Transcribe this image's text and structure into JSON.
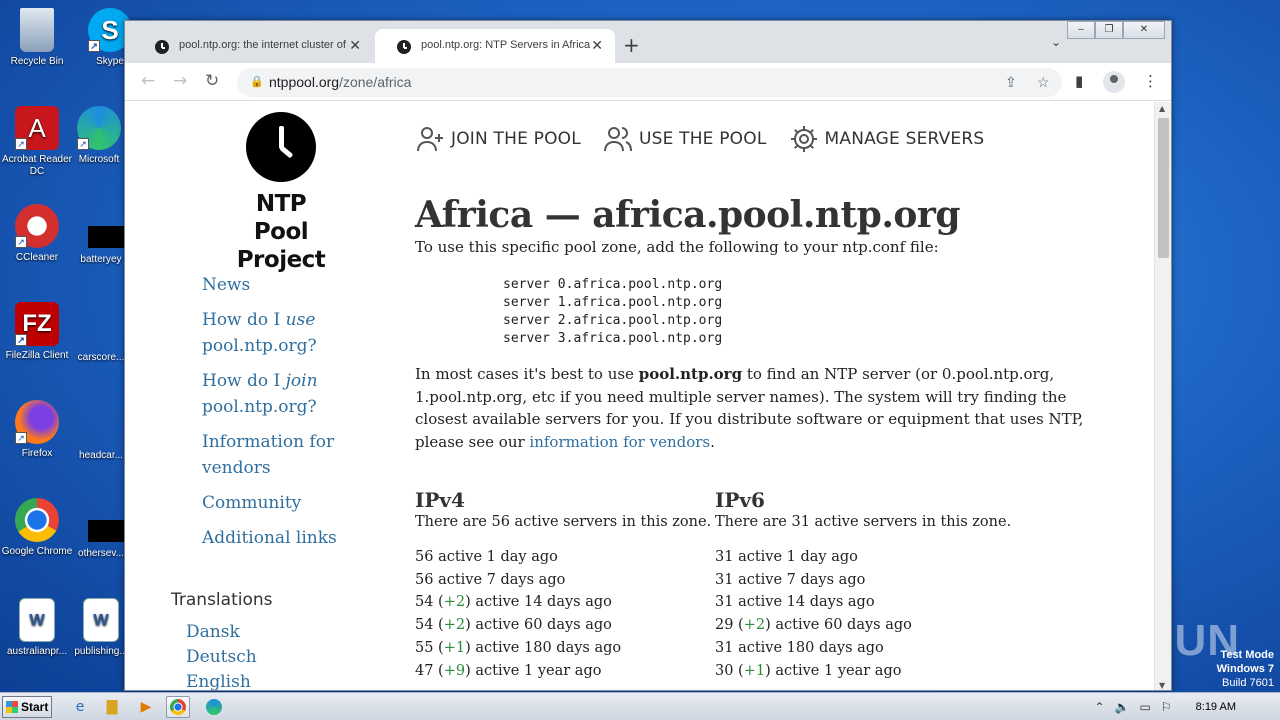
{
  "desktop": {
    "icons": [
      {
        "label": "Recycle Bin"
      },
      {
        "label": "Skype"
      },
      {
        "label": "Acrobat Reader DC"
      },
      {
        "label": "Microsoft"
      },
      {
        "label": "CCleaner"
      },
      {
        "label": "batteryey"
      },
      {
        "label": "FileZilla Client"
      },
      {
        "label": "carscore..."
      },
      {
        "label": "Firefox"
      },
      {
        "label": "headcar..."
      },
      {
        "label": "Google Chrome"
      },
      {
        "label": "othersev..."
      },
      {
        "label": "australianpr..."
      },
      {
        "label": "publishing..."
      }
    ],
    "watermark": "ANY.RUN",
    "test_mode": {
      "line1": "Test Mode",
      "line2": "Windows 7",
      "line3": "Build 7601"
    }
  },
  "taskbar": {
    "start_label": "Start",
    "clock": "8:19 AM"
  },
  "browser": {
    "tabs": [
      {
        "title": "pool.ntp.org: the internet cluster of",
        "active": false
      },
      {
        "title": "pool.ntp.org: NTP Servers in Africa,",
        "active": true
      }
    ],
    "url_host": "ntppool.org",
    "url_path": "/zone/africa"
  },
  "page": {
    "logo_line1": "NTP Pool",
    "logo_line2": "Project",
    "sidenav": {
      "news": "News",
      "use_prefix": "How do I ",
      "use_em": "use",
      "use_suffix": "pool.ntp.org?",
      "join_prefix": "How do I ",
      "join_em": "join",
      "join_suffix": "pool.ntp.org?",
      "vendors": "Information for vendors",
      "community": "Community",
      "links": "Additional links"
    },
    "translations_title": "Translations",
    "languages": [
      "Dansk",
      "Deutsch",
      "English"
    ],
    "topnav": {
      "join": "JOIN THE POOL",
      "use": "USE THE POOL",
      "manage": "MANAGE SERVERS"
    },
    "title": "Africa — africa.pool.ntp.org",
    "intro": "To use this specific pool zone, add the following to your ntp.conf file:",
    "servers": [
      "server 0.africa.pool.ntp.org",
      "server 1.africa.pool.ntp.org",
      "server 2.africa.pool.ntp.org",
      "server 3.africa.pool.ntp.org"
    ],
    "para": {
      "p1": "In most cases it's best to use ",
      "bold": "pool.ntp.org",
      "p2": " to find an NTP server (or 0.pool.ntp.org, 1.pool.ntp.org, etc if you need multiple server names). The system will try finding the closest available servers for you. If you distribute software or equipment that uses NTP, please see our ",
      "link": "information for vendors",
      "p3": "."
    },
    "ipv4": {
      "heading": "IPv4",
      "summary": "There are 56 active servers in this zone.",
      "stats": [
        {
          "count": "56",
          "delta": "",
          "label": "active 1 day ago"
        },
        {
          "count": "56",
          "delta": "",
          "label": "active 7 days ago"
        },
        {
          "count": "54",
          "delta": "+2",
          "label": "active 14 days ago"
        },
        {
          "count": "54",
          "delta": "+2",
          "label": "active 60 days ago"
        },
        {
          "count": "55",
          "delta": "+1",
          "label": "active 180 days ago"
        },
        {
          "count": "47",
          "delta": "+9",
          "label": "active 1 year ago"
        }
      ]
    },
    "ipv6": {
      "heading": "IPv6",
      "summary": "There are 31 active servers in this zone.",
      "stats": [
        {
          "count": "31",
          "delta": "",
          "label": "active 1 day ago"
        },
        {
          "count": "31",
          "delta": "",
          "label": "active 7 days ago"
        },
        {
          "count": "31",
          "delta": "",
          "label": "active 14 days ago"
        },
        {
          "count": "29",
          "delta": "+2",
          "label": "active 60 days ago"
        },
        {
          "count": "31",
          "delta": "",
          "label": "active 180 days ago"
        },
        {
          "count": "30",
          "delta": "+1",
          "label": "active 1 year ago"
        }
      ]
    }
  }
}
